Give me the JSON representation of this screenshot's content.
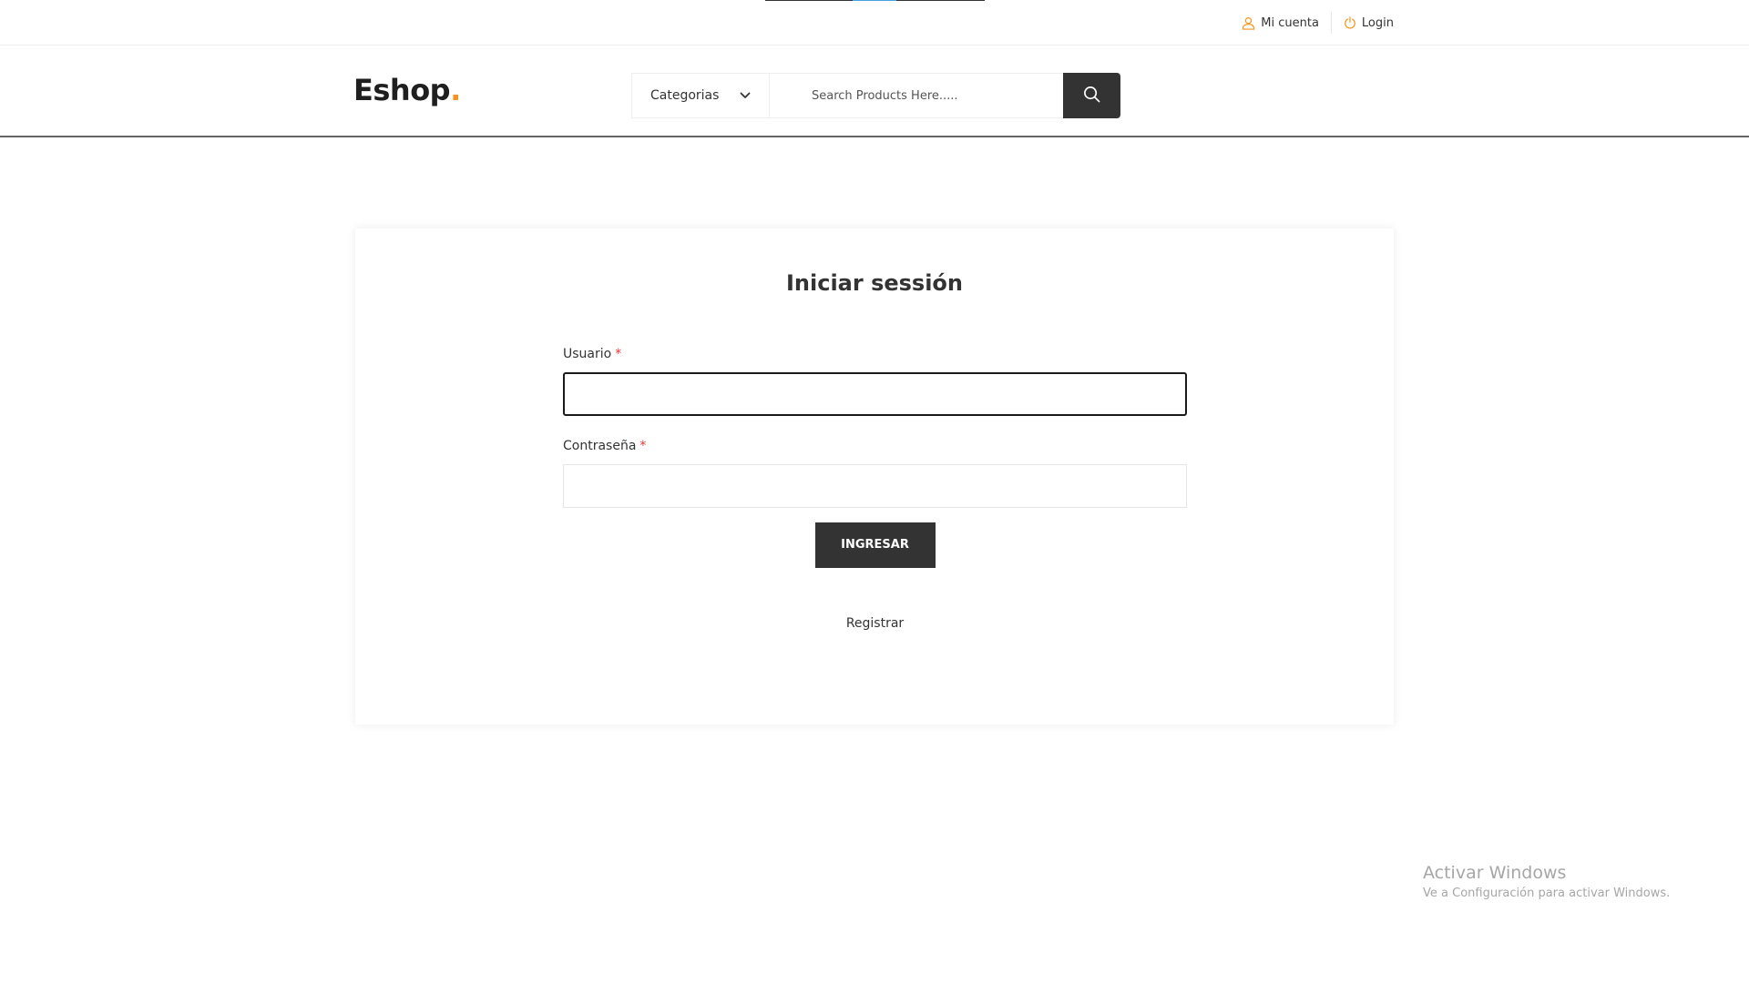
{
  "topbar": {
    "account_label": "Mi cuenta",
    "login_label": "Login",
    "accent_color": "#f7941d"
  },
  "header": {
    "logo_text": "Eshop",
    "logo_dot": ".",
    "category_select": {
      "selected": "Categorias"
    },
    "search": {
      "placeholder": "Search Products Here....."
    },
    "icons": {
      "search_button": "search-icon",
      "category_toggle": "chevron-down-icon",
      "account": "user-icon",
      "login": "power-icon"
    }
  },
  "login_form": {
    "title": "Iniciar sessión",
    "username_label": "Usuario",
    "username_required": "*",
    "username_value": "",
    "password_label": "Contraseña",
    "password_required": "*",
    "password_value": "",
    "submit_label": "INGRESAR",
    "register_label": "Registrar"
  },
  "os_watermark": {
    "title": "Activar Windows",
    "subtitle": "Ve a Configuración para activar Windows."
  }
}
